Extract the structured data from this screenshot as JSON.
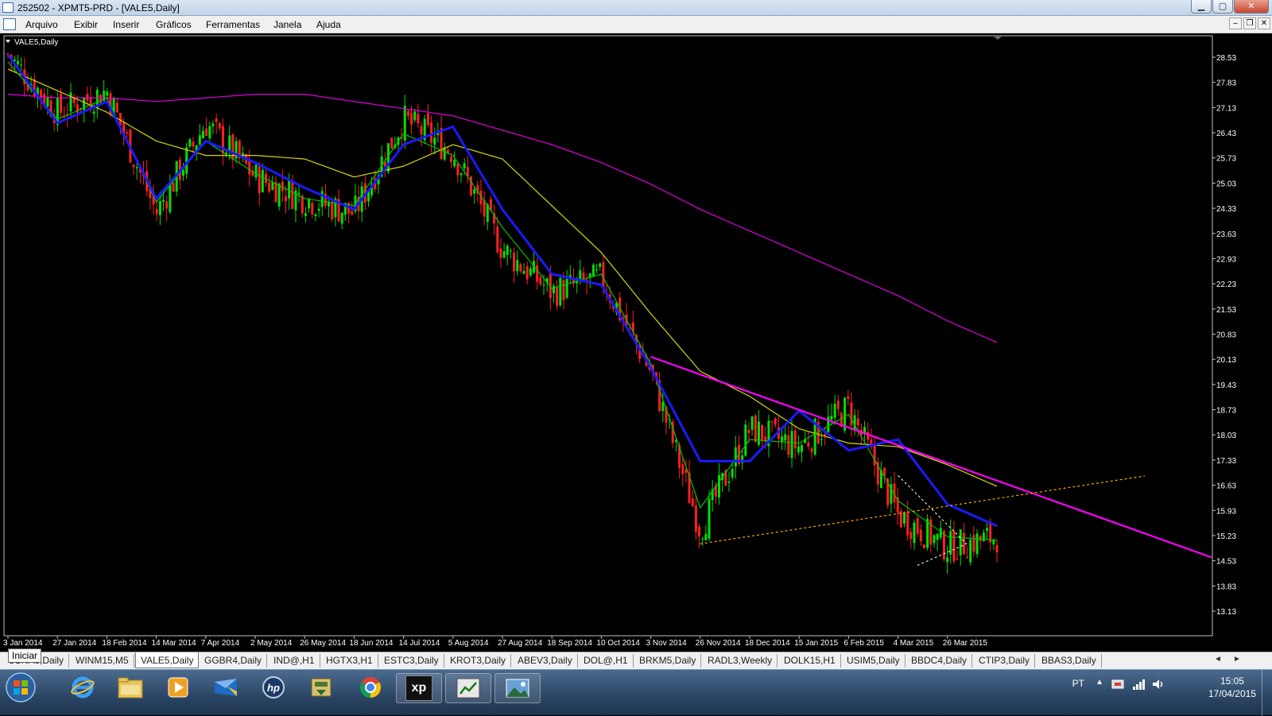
{
  "window": {
    "title": "252502 - XPMT5-PRD - [VALE5,Daily]",
    "controls": {
      "minimize": "▁",
      "maximize": "▢",
      "close": "✕"
    },
    "mdi_controls": {
      "minimize": "–",
      "restore": "❐",
      "close": "✕"
    }
  },
  "menu": {
    "items": [
      "Arquivo",
      "Exibir",
      "Inserir",
      "Gráficos",
      "Ferramentas",
      "Janela",
      "Ajuda"
    ]
  },
  "chart": {
    "symbol_label": "VALE5,Daily",
    "price_labels": [
      "28.53",
      "27.83",
      "27.13",
      "26.43",
      "25.73",
      "25.03",
      "24.33",
      "23.63",
      "22.93",
      "22.23",
      "21.53",
      "20.83",
      "20.13",
      "19.43",
      "18.73",
      "18.03",
      "17.33",
      "16.63",
      "15.93",
      "15.23",
      "14.53",
      "13.83",
      "13.13"
    ],
    "date_labels": [
      "3 Jan 2014",
      "27 Jan 2014",
      "18 Feb 2014",
      "14 Mar 2014",
      "7 Apr 2014",
      "2 May 2014",
      "26 May 2014",
      "18 Jun 2014",
      "14 Jul 2014",
      "5 Aug 2014",
      "27 Aug 2014",
      "18 Sep 2014",
      "10 Oct 2014",
      "3 Nov 2014",
      "26 Nov 2014",
      "18 Dec 2014",
      "15 Jan 2015",
      "6 Feb 2015",
      "4 Mar 2015",
      "26 Mar 2015"
    ],
    "colors": {
      "background": "#000000",
      "up_candle": "#00e000",
      "down_candle": "#ff2020",
      "ma_fast": "#00c000",
      "ma_mid": "#1a1aff",
      "ma_slow": "#d8d800",
      "ma_long": "#e000e0",
      "trendline": "#ff00ff",
      "dotted_orange": "#ffa500",
      "dotted_white": "#ffffff",
      "axis_text": "#ffffff"
    }
  },
  "chart_data": {
    "type": "candlestick",
    "title": "VALE5,Daily",
    "price_range": [
      12.8,
      29.0
    ],
    "x": [
      "3 Jan 2014",
      "27 Jan 2014",
      "18 Feb 2014",
      "14 Mar 2014",
      "7 Apr 2014",
      "2 May 2014",
      "26 May 2014",
      "18 Jun 2014",
      "14 Jul 2014",
      "5 Aug 2014",
      "27 Aug 2014",
      "18 Sep 2014",
      "10 Oct 2014",
      "3 Nov 2014",
      "26 Nov 2014",
      "18 Dec 2014",
      "15 Jan 2015",
      "6 Feb 2015",
      "4 Mar 2015",
      "26 Mar 2015",
      "17 Apr 2015"
    ],
    "close_path": [
      28.6,
      27.0,
      27.6,
      24.2,
      26.7,
      25.2,
      24.6,
      24.2,
      26.8,
      25.9,
      23.2,
      22.0,
      22.4,
      19.8,
      15.4,
      18.2,
      17.7,
      18.8,
      15.8,
      14.9,
      15.2
    ],
    "ma_fast": [
      28.4,
      26.8,
      27.4,
      24.5,
      26.2,
      25.3,
      24.6,
      24.4,
      26.4,
      25.8,
      23.8,
      22.1,
      22.5,
      20.0,
      16.0,
      17.9,
      17.8,
      18.6,
      16.2,
      15.2,
      15.1
    ],
    "ma_mid": [
      28.6,
      26.7,
      27.3,
      24.6,
      26.2,
      25.6,
      24.9,
      24.3,
      26.1,
      26.6,
      24.3,
      22.5,
      22.2,
      19.9,
      17.3,
      17.3,
      18.7,
      17.6,
      17.9,
      16.1,
      15.5
    ],
    "ma_slow": [
      28.2,
      27.6,
      27.0,
      26.2,
      25.8,
      25.8,
      25.7,
      25.2,
      25.5,
      26.1,
      25.7,
      24.4,
      23.1,
      21.4,
      19.8,
      19.1,
      18.2,
      17.8,
      17.7,
      17.2,
      16.6
    ],
    "ma_long": [
      27.5,
      27.4,
      27.4,
      27.3,
      27.4,
      27.5,
      27.5,
      27.3,
      27.1,
      26.9,
      26.5,
      26.1,
      25.6,
      25.0,
      24.3,
      23.7,
      23.1,
      22.5,
      21.9,
      21.2,
      20.6
    ],
    "trendline_desc": {
      "from": {
        "x": "3 Nov 2014",
        "y": 20.2
      },
      "to": {
        "x": "26 Mar 2015",
        "y": 17.25
      }
    },
    "dotted_support": {
      "from": {
        "x": "26 Nov 2014",
        "y": 15.0
      },
      "to": {
        "x": "26 Mar 2015",
        "y": 16.05
      }
    },
    "triangle": {
      "upper": {
        "from": {
          "x": "4 Mar 2015",
          "y": 16.9
        },
        "to": {
          "x": "26 Mar 2015",
          "y": 15.0
        }
      },
      "lower": {
        "from": {
          "x": "26 Mar 2015",
          "y": 14.4
        },
        "to": {
          "x": "26 Mar 2015",
          "y": 15.0
        }
      }
    }
  },
  "tabs": {
    "items": [
      "CSNA3,Daily",
      "WINM15,M5",
      "VALE5,Daily",
      "GGBR4,Daily",
      "IND@,H1",
      "HGTX3,H1",
      "ESTC3,Daily",
      "KROT3,Daily",
      "ABEV3,Daily",
      "DOL@,H1",
      "BRKM5,Daily",
      "RADL3,Weekly",
      "DOLK15,H1",
      "USIM5,Daily",
      "BBDC4,Daily",
      "CTIP3,Daily",
      "BBAS3,Daily"
    ],
    "active": "VALE5,Daily",
    "scroll_left": "◄",
    "scroll_right": "►"
  },
  "tooltip": {
    "text": "Iniciar"
  },
  "taskbar": {
    "items": [
      "start-orb",
      "internet-explorer",
      "file-explorer",
      "media-player",
      "outlook",
      "hp",
      "app-manager",
      "chrome",
      "xp-investimentos",
      "metatrader-window",
      "image-viewer"
    ],
    "xp_label": "xp",
    "lang": "PT",
    "time": "15:05",
    "date": "17/04/2015"
  }
}
